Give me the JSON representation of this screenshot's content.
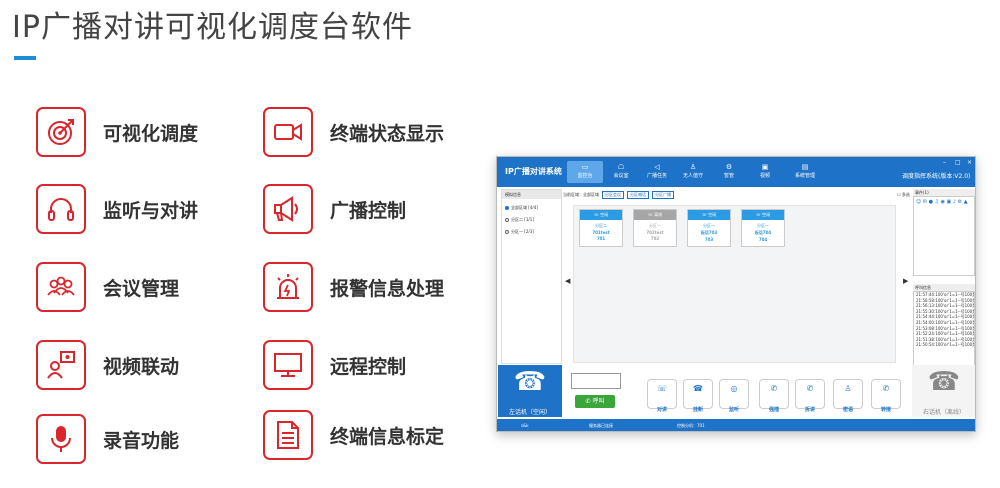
{
  "page_title": "IP广播对讲可视化调度台软件",
  "features": [
    {
      "icon": "target-icon",
      "label": "可视化调度"
    },
    {
      "icon": "camera-icon",
      "label": "终端状态显示"
    },
    {
      "icon": "headset-icon",
      "label": "监听与对讲"
    },
    {
      "icon": "megaphone-icon",
      "label": "广播控制"
    },
    {
      "icon": "meeting-icon",
      "label": "会议管理"
    },
    {
      "icon": "alarm-light-icon",
      "label": "报警信息处理"
    },
    {
      "icon": "video-link-icon",
      "label": "视频联动"
    },
    {
      "icon": "monitor-icon",
      "label": "远程控制"
    },
    {
      "icon": "microphone-icon",
      "label": "录音功能"
    },
    {
      "icon": "document-icon",
      "label": "终端信息标定"
    }
  ],
  "app": {
    "title": "IP广播对讲系统",
    "subtitle": "调度指挥系统(版本:V2.0)",
    "nav": [
      {
        "icon": "monitor-icon",
        "label": "监控台"
      },
      {
        "icon": "meeting-icon",
        "label": "会议室"
      },
      {
        "icon": "broadcast-icon",
        "label": "广播任务"
      },
      {
        "icon": "person-icon",
        "label": "无人值守"
      },
      {
        "icon": "gear-icon",
        "label": "暂管"
      },
      {
        "icon": "video-icon",
        "label": "视频"
      },
      {
        "icon": "computer-icon",
        "label": "系统管理"
      }
    ],
    "left_panel": {
      "header": "模拟信息",
      "items": [
        "全部区域 [4/4]",
        "分区二 [1/1]",
        "分区一 [2/3]"
      ]
    },
    "toolbar": {
      "label": "当前区域：全部区域",
      "btn1": "分区会议",
      "btn2": "分区喊话",
      "btn3": "分区广播",
      "multi": "多选"
    },
    "terminals": [
      {
        "status": "空闲",
        "area": "分区二",
        "name": "701test",
        "number": "701",
        "color": "#2b9be3"
      },
      {
        "status": "离线",
        "area": "分区一",
        "name": "702test",
        "number": "702",
        "color": "#a6a6a6"
      },
      {
        "status": "空闲",
        "area": "分区一",
        "name": "板话703",
        "number": "703",
        "color": "#2b9be3"
      },
      {
        "status": "空闲",
        "area": "分区一",
        "name": "板话704",
        "number": "704",
        "color": "#2b9be3"
      }
    ],
    "right_panel": {
      "msg_header": "事件(1)",
      "log_header": "呼叫信息",
      "logs": [
        "21:57:44:100'or'1=1--号100是",
        "21:56:58:100'or'1=1--号100是",
        "21:56:13:100'or'1=1--号100是",
        "21:55:30:100'or'1=1--号100是",
        "21:54:44:100'or'1=1--号100是",
        "21:54:00:100'or'1=1--号100是",
        "21:53:08:100'or'1=1--号100是",
        "21:52:24:100'or'1=1--号100是",
        "21:51:38:100'or'1=1--号100是",
        "21:50:54:100'or'1=1--号100是"
      ]
    },
    "left_phone": "左话机（空闲）",
    "right_phone": "右话机（离线）",
    "call_button": "呼叫",
    "actions": [
      {
        "icon": "handset-icon",
        "label": "对讲"
      },
      {
        "icon": "hangup-icon",
        "label": "挂断"
      },
      {
        "icon": "headset-icon",
        "label": "监听"
      },
      {
        "icon": "phone-force-icon",
        "label": "强插"
      },
      {
        "icon": "phone-split-icon",
        "label": "拆讲"
      },
      {
        "icon": "person-whisper-icon",
        "label": "密语"
      },
      {
        "icon": "phone-transfer-icon",
        "label": "转接"
      }
    ],
    "status": {
      "user": "s&k",
      "server": "服务器已连接",
      "controller": "控制分机：701"
    }
  }
}
